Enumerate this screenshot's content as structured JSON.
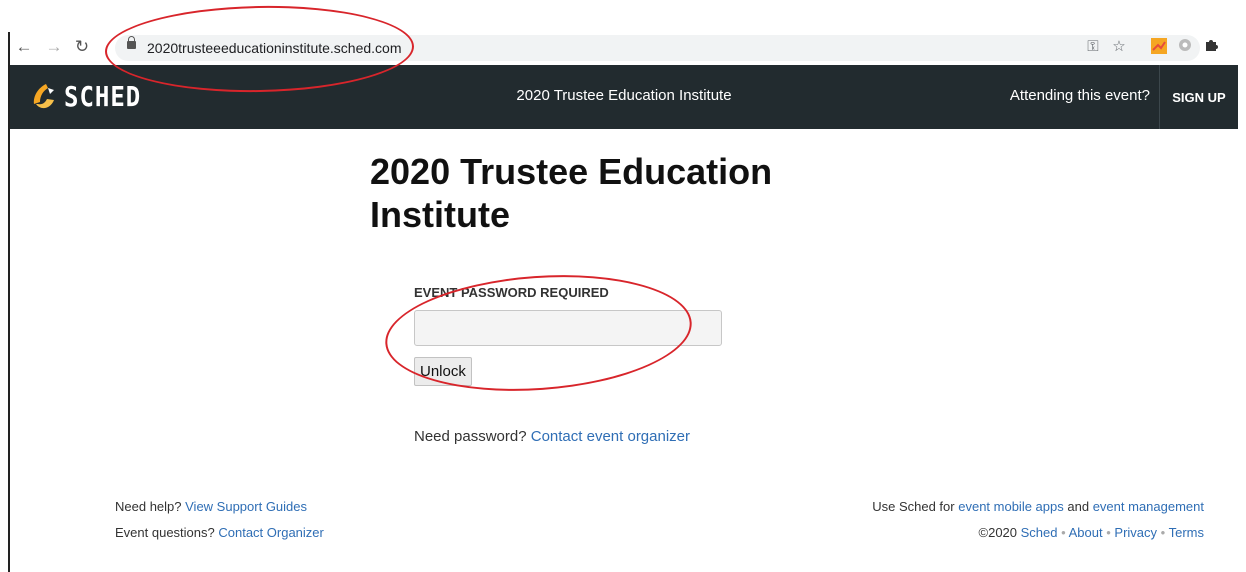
{
  "browser": {
    "url": "2020trusteeeducationinstitute.sched.com"
  },
  "header": {
    "logo_text": "SCHED",
    "event_title": "2020 Trustee Education Institute",
    "attending_prompt": "Attending this event?",
    "signup_label": "SIGN UP"
  },
  "main": {
    "title": "2020 Trustee Education Institute",
    "password_label": "EVENT PASSWORD REQUIRED",
    "password_value": "",
    "unlock_label": "Unlock",
    "need_password_text": "Need password?",
    "contact_organizer_link": "Contact event organizer"
  },
  "footer": {
    "help_text": "Need help?",
    "support_link": "View Support Guides",
    "questions_text": "Event questions?",
    "contact_link": "Contact Organizer",
    "use_sched_text": "Use Sched for",
    "mobile_apps_link": "event mobile apps",
    "and_text": "and",
    "event_management_link": "event management",
    "copyright": "©2020",
    "sched_link": "Sched",
    "about_link": "About",
    "privacy_link": "Privacy",
    "terms_link": "Terms",
    "separator": "•"
  },
  "colors": {
    "header_bg": "#222b2f",
    "link": "#2f6eb5",
    "annotation": "#d8252b",
    "logo_orange": "#f5a623"
  },
  "icons": [
    "back-arrow-icon",
    "forward-arrow-icon",
    "reload-icon",
    "lock-icon",
    "key-icon",
    "star-icon",
    "extension-icon",
    "puzzle-icon",
    "sched-logo-icon"
  ]
}
